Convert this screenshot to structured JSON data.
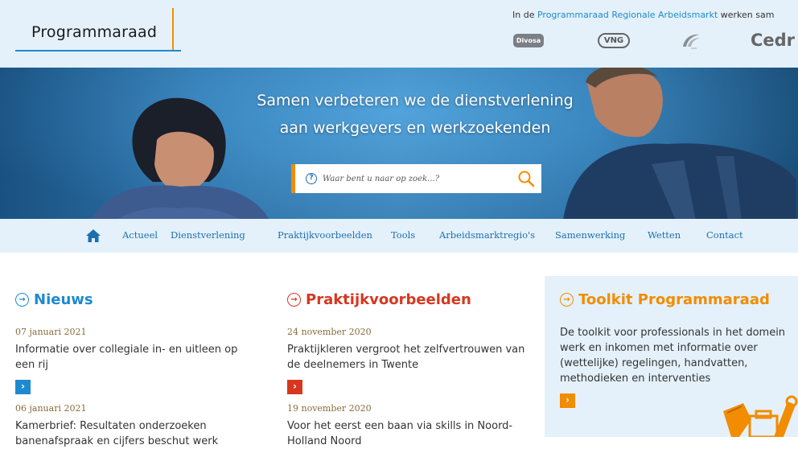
{
  "header": {
    "logo_text": "Programmaraad",
    "partners_prefix": "In de ",
    "partners_link": "Programmaraad Regionale Arbeidsmarkt",
    "partners_suffix": " werken sam",
    "partner_logos": [
      "Divosa",
      "VNG",
      "UWV",
      "Cedr"
    ]
  },
  "hero": {
    "title_line1": "Samen verbeteren we de dienstverlening",
    "title_line2": "aan werkgevers en werkzoekenden",
    "search_placeholder": "Waar bent u naar op zoek...?",
    "help_glyph": "?"
  },
  "nav": {
    "home_icon": "home-icon",
    "items": [
      "Actueel",
      "Dienstverlening",
      "Praktijkvoorbeelden",
      "Tools",
      "Arbeidsmarktregio's",
      "Samenwerking",
      "Wetten",
      "Contact"
    ]
  },
  "nieuws": {
    "title": "Nieuws",
    "items": [
      {
        "date": "07 januari 2021",
        "text": "Informatie over collegiale in- en uitleen op een rij"
      },
      {
        "date": "06 januari 2021",
        "text": "Kamerbrief: Resultaten onderzoeken banenafspraak en cijfers beschut werk"
      }
    ]
  },
  "praktijk": {
    "title": "Praktijkvoorbeelden",
    "items": [
      {
        "date": "24 november 2020",
        "text": "Praktijkleren vergroot het zelfvertrouwen van de deelnemers in Twente"
      },
      {
        "date": "19 november 2020",
        "text": "Voor het eerst een baan via skills in Noord-Holland Noord"
      }
    ]
  },
  "toolkit": {
    "title": "Toolkit Programmaraad",
    "text": "De toolkit voor professionals in het domein werk en inkomen met informatie over (wettelijke) regelingen, handvatten, methodieken en interventies"
  },
  "glyphs": {
    "arrow": "›",
    "circle_arrow": "→"
  },
  "colors": {
    "blue": "#1d8ad0",
    "red": "#d7371f",
    "orange": "#f28c00",
    "light_bg": "#e4f1fa"
  }
}
